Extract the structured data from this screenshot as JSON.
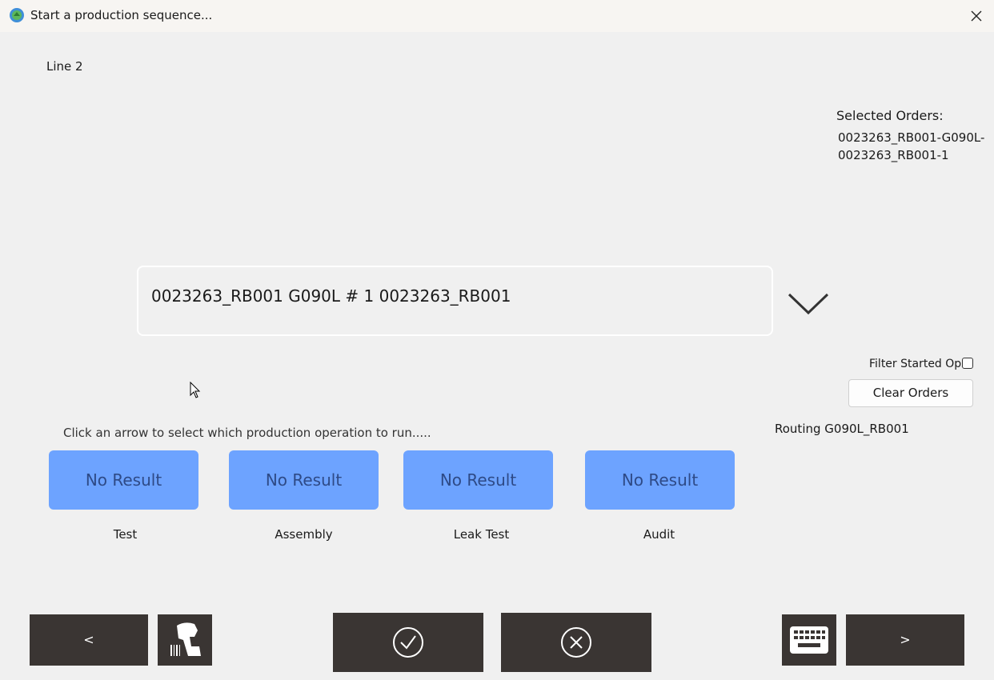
{
  "window": {
    "title": "Start a production sequence..."
  },
  "line": "Line 2",
  "selected_orders": {
    "title": "Selected Orders:",
    "items": [
      "0023263_RB001-G090L-",
      "0023263_RB001-1"
    ]
  },
  "combo": {
    "value": "0023263_RB001 G090L # 1 0023263_RB001",
    "icon": "chevron-down-icon"
  },
  "filter": {
    "label": "Filter Started Ops",
    "checked": false
  },
  "clear_orders": "Clear Orders",
  "instruction": "Click an arrow to select which production operation to run.....",
  "routing": "Routing G090L_RB001",
  "operations": [
    {
      "result": "No Result",
      "label": "Test"
    },
    {
      "result": "No Result",
      "label": "Assembly"
    },
    {
      "result": "No Result",
      "label": "Leak Test"
    },
    {
      "result": "No Result",
      "label": "Audit"
    }
  ],
  "toolbar": {
    "prev": "<",
    "next": ">",
    "icons": [
      "barcode-scanner-icon",
      "check-icon",
      "cancel-icon",
      "keyboard-icon"
    ]
  },
  "colors": {
    "op_button": "#6da3ff",
    "toolbar_button": "#3a3533",
    "background": "#f0f0f0"
  }
}
